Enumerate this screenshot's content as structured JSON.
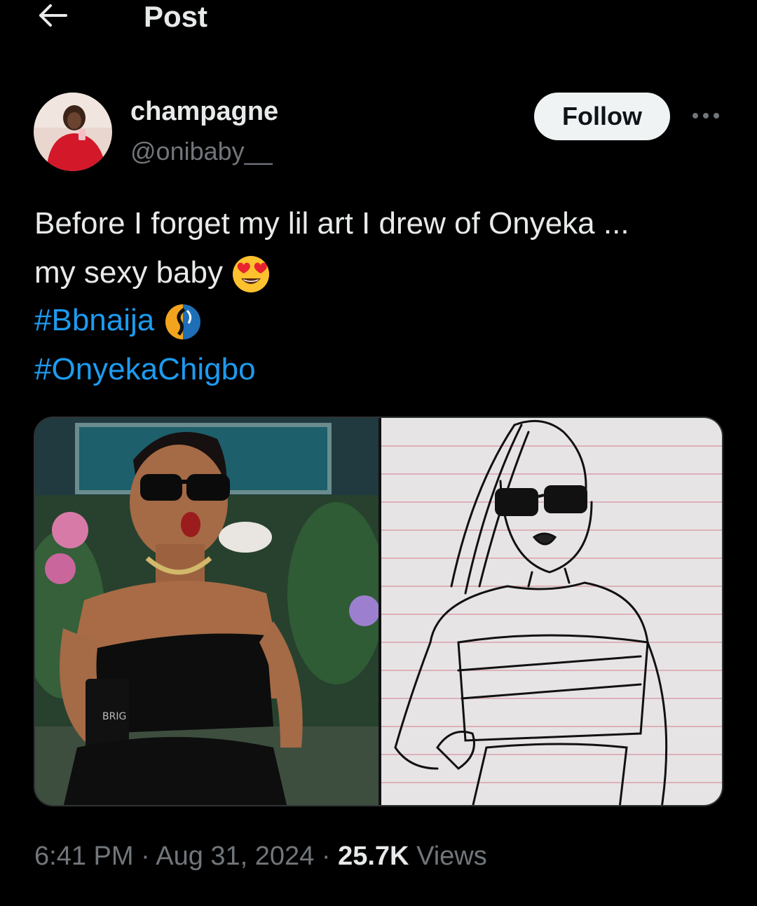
{
  "header": {
    "title": "Post",
    "back_icon": "arrow-left-icon"
  },
  "author": {
    "name": "champagne",
    "handle": "@onibaby__",
    "follow_label": "Follow",
    "more_icon": "more-dots-icon"
  },
  "post": {
    "line1": "Before I forget my lil art I drew of Onyeka ...",
    "line2": "my sexy baby",
    "hashtag1": "#Bbnaija",
    "hashtag2": "#OnyekaChigbo",
    "emoji1": "heart-eyes-emoji",
    "emoji2": "bbnaija-emoji"
  },
  "media": {
    "left_image": "photo-of-woman-in-black-tube-top",
    "right_image": "pen-sketch-on-lined-paper"
  },
  "meta": {
    "time": "6:41 PM",
    "sep": "·",
    "date": "Aug 31, 2024",
    "views_count": "25.7K",
    "views_label": "Views"
  },
  "colors": {
    "accent": "#1d9bf0",
    "muted": "#71767b",
    "text": "#e7e9ea"
  }
}
